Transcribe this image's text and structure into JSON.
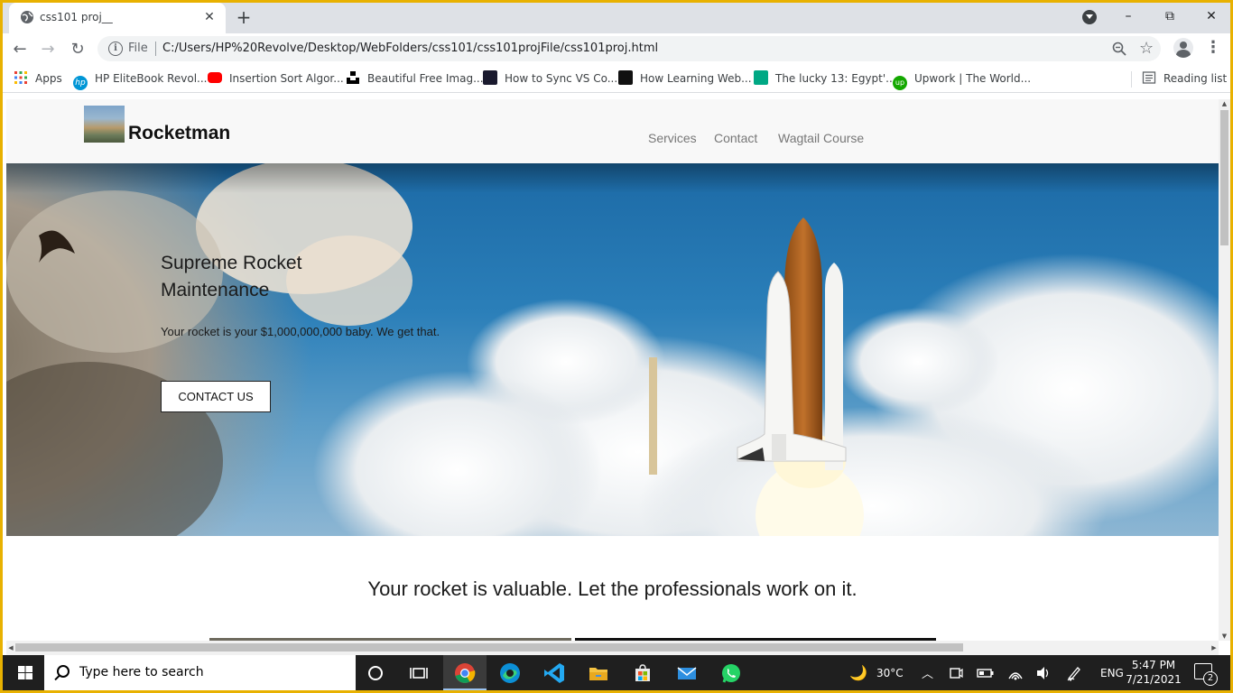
{
  "browser": {
    "tab_title": "css101 proj__",
    "file_label": "File",
    "url": "C:/Users/HP%20Revolve/Desktop/WebFolders/css101/css101projFile/css101proj.html",
    "window_controls": [
      "–",
      "⧉",
      "✕"
    ]
  },
  "bookmarks": [
    {
      "label": "Apps",
      "icon": "apps-grid-icon",
      "color": "#e8453c"
    },
    {
      "label": "HP EliteBook Revol...",
      "icon": "hp-logo-icon",
      "color": "#0096d6"
    },
    {
      "label": "Insertion Sort Algor...",
      "icon": "youtube-icon",
      "color": "#ff0000"
    },
    {
      "label": "Beautiful Free Imag...",
      "icon": "unsplash-icon",
      "color": "#000000"
    },
    {
      "label": "How to Sync VS Co...",
      "icon": "site-icon",
      "color": "#1a1a2e"
    },
    {
      "label": "How Learning Web...",
      "icon": "site-icon",
      "color": "#111111"
    },
    {
      "label": "The lucky 13: Egypt'...",
      "icon": "site-icon",
      "color": "#00a884"
    },
    {
      "label": "Upwork | The World...",
      "icon": "upwork-icon",
      "color": "#14a800"
    }
  ],
  "reading_list": "Reading list",
  "site": {
    "brand": "Rocketman",
    "nav": [
      "Services",
      "Contact",
      "Wagtail Course"
    ],
    "hero_title": "Supreme Rocket Maintenance",
    "hero_subtitle": "Your rocket is your $1,000,000,000 baby. We get that.",
    "hero_button": "CONTACT US",
    "tagline": "Your rocket is valuable. Let the professionals work on it."
  },
  "taskbar": {
    "search_placeholder": "Type here to search",
    "temperature": "30°C",
    "language": "ENG",
    "time": "5:47 PM",
    "date": "7/21/2021",
    "notification_count": "2"
  }
}
